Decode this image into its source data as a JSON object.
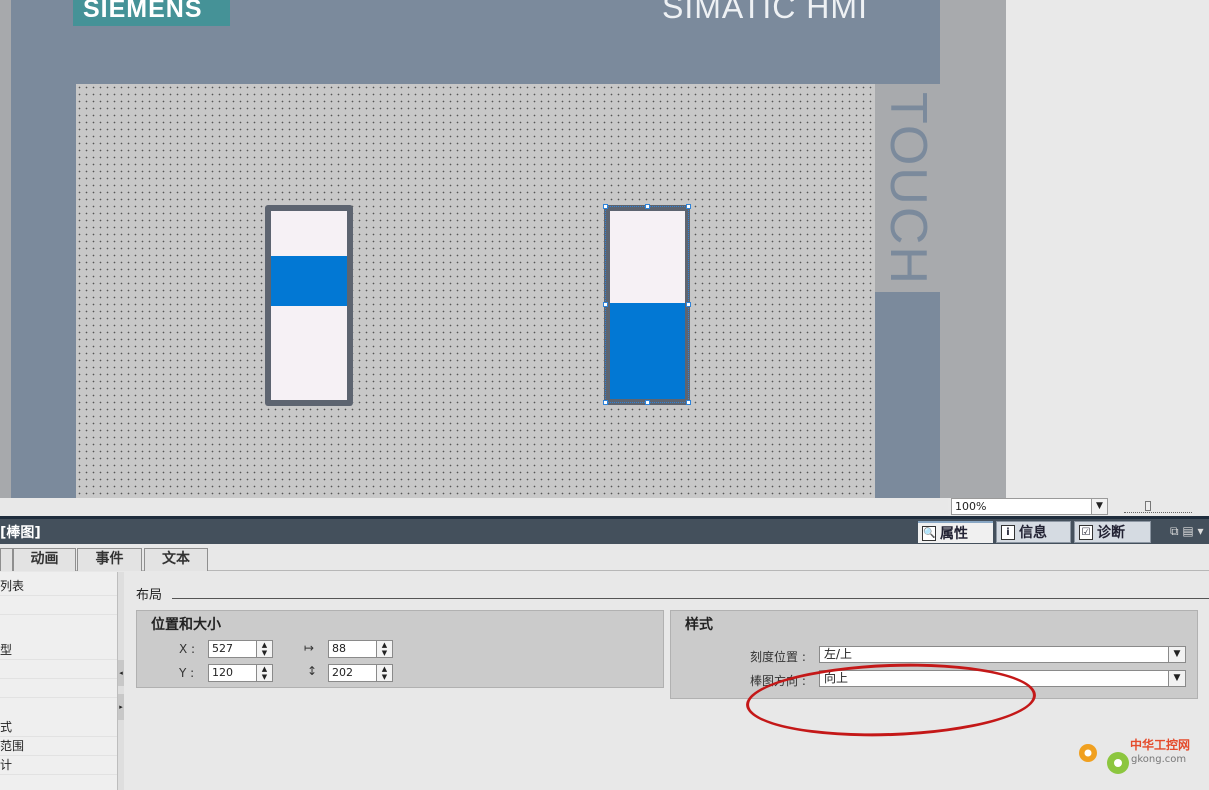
{
  "hmi": {
    "brand": "SIEMENS",
    "title": "SIMATIC HMI",
    "side_label": "TOUCH"
  },
  "screen": {
    "bars": [
      {
        "name": "bar-1",
        "fill_from": 0.5,
        "fill_to": 0.76
      },
      {
        "name": "bar-2",
        "fill_from": 0.0,
        "fill_to": 0.51,
        "selected": true
      }
    ],
    "fill_color": "#0278d4",
    "track_color": "#f6f1f5"
  },
  "zoom": {
    "value": "100%",
    "arrow": "▼"
  },
  "panel": {
    "title": "[棒图]",
    "tabs": [
      {
        "label": "属性",
        "icon": "🔍"
      },
      {
        "label": "信息",
        "icon": "i"
      },
      {
        "label": "诊断",
        "icon": "☑"
      }
    ],
    "window_icons": "⧉ ▤ ▾"
  },
  "subtabs": [
    "动画",
    "事件",
    "文本"
  ],
  "nav": {
    "items": [
      "列表",
      "",
      "型",
      "",
      "",
      "式",
      "范围",
      "计",
      ""
    ]
  },
  "layout": {
    "section": "布局",
    "pos_group": {
      "title": "位置和大小",
      "x_label": "X :",
      "y_label": "Y :",
      "x_value": "527",
      "y_value": "120",
      "width_value": "88",
      "height_value": "202"
    },
    "style_group": {
      "title": "样式",
      "scale_label": "刻度位置 :",
      "scale_value": "左/上",
      "direction_label": "棒图方向 :",
      "direction_value": "向上"
    }
  },
  "watermark": {
    "cn": "中华工控网",
    "url": "gkong.com"
  },
  "colors": {
    "annotation": "#c41818",
    "hmi_frame": "#7b8a9c",
    "brand": "#459297"
  }
}
